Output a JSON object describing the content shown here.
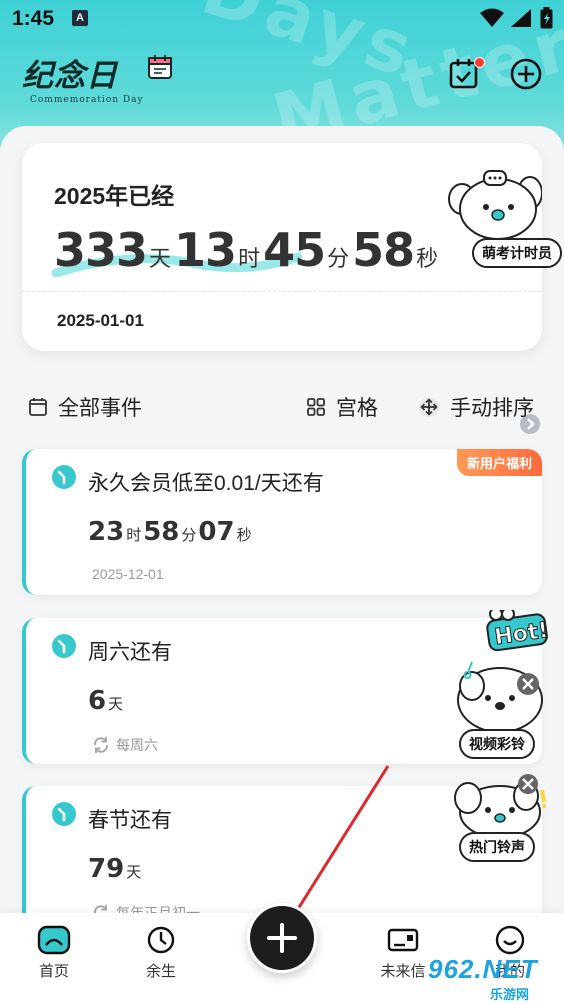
{
  "status_bar": {
    "time": "1:45",
    "notif_icon": "A"
  },
  "app": {
    "logo_title": "纪念日",
    "logo_subtitle": "Commemoration Day",
    "watermark_1": "Days",
    "watermark_2": "Matter"
  },
  "year_card": {
    "title": "2025年已经",
    "days": "333",
    "days_unit": "天",
    "hours": "13",
    "hours_unit": "时",
    "minutes": "45",
    "minutes_unit": "分",
    "seconds": "58",
    "seconds_unit": "秒",
    "date": "2025-01-01",
    "mascot_label": "萌考计时员"
  },
  "filters": {
    "all_events": "全部事件",
    "grid": "宫格",
    "sort": "手动排序"
  },
  "events": [
    {
      "title": "永久会员低至0.01/天还有",
      "tag": "新用户福利",
      "count": [
        {
          "n": "23",
          "u": "时"
        },
        {
          "n": "58",
          "u": "分"
        },
        {
          "n": "07",
          "u": "秒"
        }
      ],
      "sub": "2025-12-01"
    },
    {
      "title": "周六还有",
      "count": [
        {
          "n": "6",
          "u": "天"
        }
      ],
      "sub": "每周六"
    },
    {
      "title": "春节还有",
      "count": [
        {
          "n": "79",
          "u": "天"
        }
      ],
      "sub": "每年正月初一"
    }
  ],
  "floating": {
    "hot_badge": "Hot!",
    "label_1": "视频彩铃",
    "label_2": "热门铃声"
  },
  "nav": {
    "home": "首页",
    "yusheng": "余生",
    "future": "未来信",
    "mine": "我的"
  },
  "site_watermark": {
    "text": "962.NET",
    "sub": "乐游网"
  },
  "colors": {
    "accent": "#36c8cc",
    "hero": "#3fd1d6",
    "tag": "#ff6a3d",
    "fab": "#1d1d1f"
  }
}
